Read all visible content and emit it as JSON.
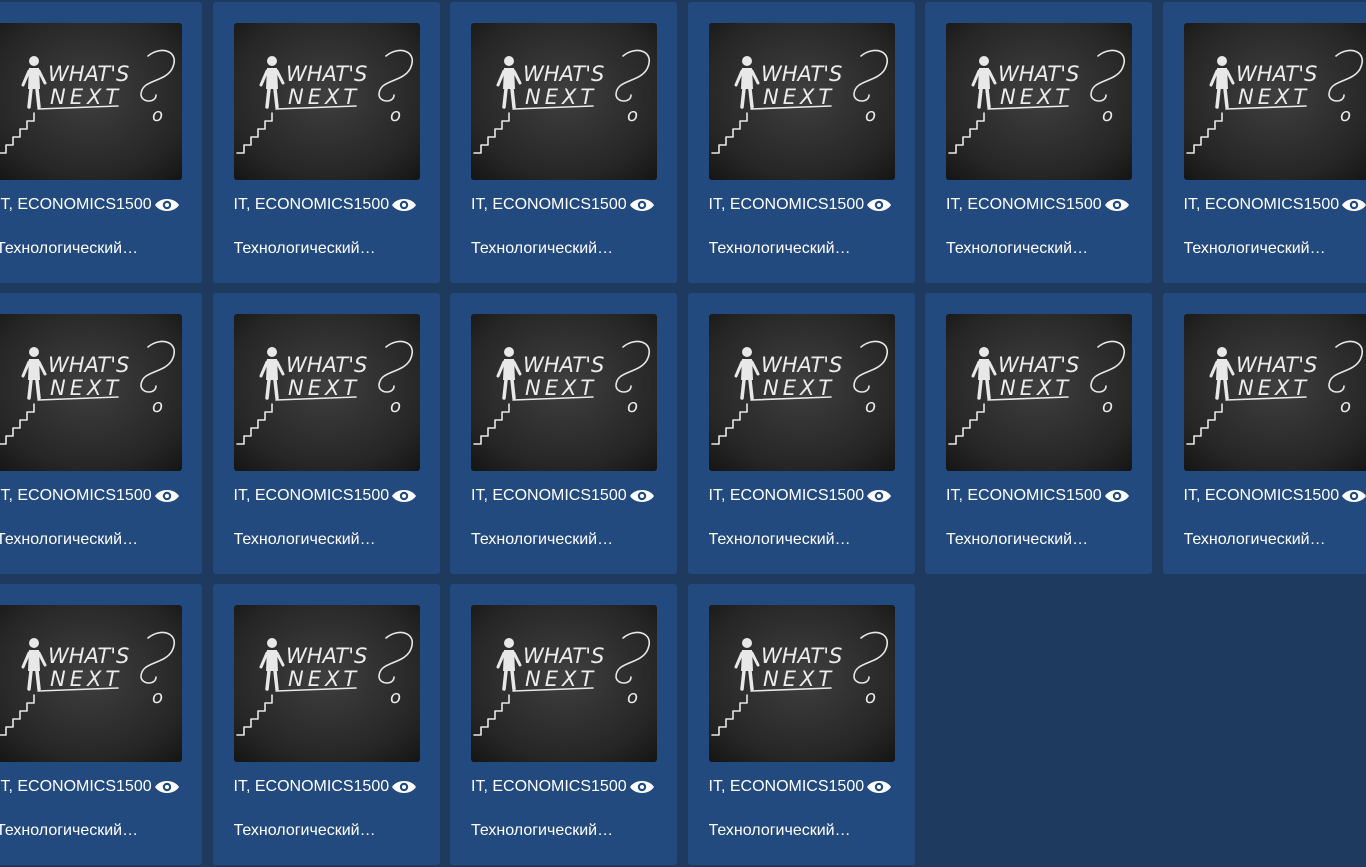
{
  "cards": [
    {
      "tags": "IT, ECONOMICS",
      "views": "1500",
      "title": "Технологический…",
      "image": "whats-next-chalkboard",
      "icon": "eye-icon"
    },
    {
      "tags": "IT, ECONOMICS",
      "views": "1500",
      "title": "Технологический…",
      "image": "whats-next-chalkboard",
      "icon": "eye-icon"
    },
    {
      "tags": "IT, ECONOMICS",
      "views": "1500",
      "title": "Технологический…",
      "image": "whats-next-chalkboard",
      "icon": "eye-icon"
    },
    {
      "tags": "IT, ECONOMICS",
      "views": "1500",
      "title": "Технологический…",
      "image": "whats-next-chalkboard",
      "icon": "eye-icon"
    },
    {
      "tags": "IT, ECONOMICS",
      "views": "1500",
      "title": "Технологический…",
      "image": "whats-next-chalkboard",
      "icon": "eye-icon"
    },
    {
      "tags": "IT, ECONOMICS",
      "views": "1500",
      "title": "Технологический…",
      "image": "whats-next-chalkboard",
      "icon": "eye-icon"
    },
    {
      "tags": "IT, ECONOMICS",
      "views": "1500",
      "title": "Технологический…",
      "image": "whats-next-chalkboard",
      "icon": "eye-icon"
    },
    {
      "tags": "IT, ECONOMICS",
      "views": "1500",
      "title": "Технологический…",
      "image": "whats-next-chalkboard",
      "icon": "eye-icon"
    },
    {
      "tags": "IT, ECONOMICS",
      "views": "1500",
      "title": "Технологический…",
      "image": "whats-next-chalkboard",
      "icon": "eye-icon"
    },
    {
      "tags": "IT, ECONOMICS",
      "views": "1500",
      "title": "Технологический…",
      "image": "whats-next-chalkboard",
      "icon": "eye-icon"
    },
    {
      "tags": "IT, ECONOMICS",
      "views": "1500",
      "title": "Технологический…",
      "image": "whats-next-chalkboard",
      "icon": "eye-icon"
    },
    {
      "tags": "IT, ECONOMICS",
      "views": "1500",
      "title": "Технологический…",
      "image": "whats-next-chalkboard",
      "icon": "eye-icon"
    },
    {
      "tags": "IT, ECONOMICS",
      "views": "1500",
      "title": "Технологический…",
      "image": "whats-next-chalkboard",
      "icon": "eye-icon"
    },
    {
      "tags": "IT, ECONOMICS",
      "views": "1500",
      "title": "Технологический…",
      "image": "whats-next-chalkboard",
      "icon": "eye-icon"
    },
    {
      "tags": "IT, ECONOMICS",
      "views": "1500",
      "title": "Технологический…",
      "image": "whats-next-chalkboard",
      "icon": "eye-icon"
    },
    {
      "tags": "IT, ECONOMICS",
      "views": "1500",
      "title": "Технологический…",
      "image": "whats-next-chalkboard",
      "icon": "eye-icon"
    }
  ],
  "image_text": {
    "line1": "WHAT'S",
    "line2": "NEXT"
  },
  "colors": {
    "page_background": "#1f3a5f",
    "card_background": "#234a7e",
    "text": "#ffffff",
    "chalkboard": "#2b2b2b"
  }
}
